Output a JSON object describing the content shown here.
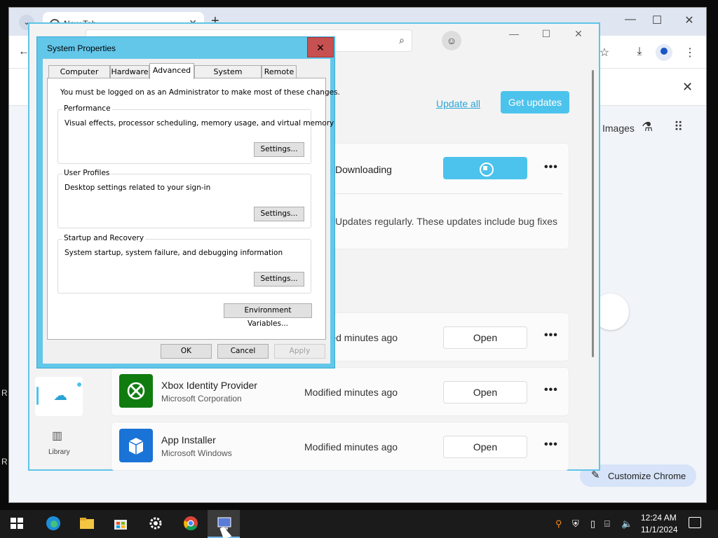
{
  "chrome": {
    "tab_title": "New Tab",
    "infobar_close": "✕",
    "images_link": "Images",
    "customize_label": "Customize Chrome"
  },
  "store": {
    "update_all": "Update all",
    "get_updates": "Get updates",
    "downloading": "Downloading",
    "description": "Updates regularly. These updates include bug fixes",
    "apps": [
      {
        "name": "",
        "publisher": "",
        "modified": "Modified minutes ago",
        "action": "Open"
      },
      {
        "name": "Xbox Identity Provider",
        "publisher": "Microsoft Corporation",
        "modified": "Modified minutes ago",
        "action": "Open"
      },
      {
        "name": "App Installer",
        "publisher": "Microsoft Windows",
        "modified": "Modified minutes ago",
        "action": "Open"
      }
    ],
    "nav_library": "Library"
  },
  "sysprop": {
    "title": "System Properties",
    "close": "✕",
    "tabs": [
      "Computer Name",
      "Hardware",
      "Advanced",
      "System Protection",
      "Remote"
    ],
    "active_tab": "Advanced",
    "admin_note": "You must be logged on as an Administrator to make most of these changes.",
    "groups": [
      {
        "title": "Performance",
        "desc": "Visual effects, processor scheduling, memory usage, and virtual memory",
        "button": "Settings..."
      },
      {
        "title": "User Profiles",
        "desc": "Desktop settings related to your sign-in",
        "button": "Settings..."
      },
      {
        "title": "Startup and Recovery",
        "desc": "System startup, system failure, and debugging information",
        "button": "Settings..."
      }
    ],
    "env_button": "Environment Variables...",
    "ok": "OK",
    "cancel": "Cancel",
    "apply": "Apply"
  },
  "taskbar": {
    "time": "12:24 AM",
    "date": "11/1/2024"
  },
  "desktop": {
    "letter_top": "R",
    "letter_bottom": "R"
  },
  "colors": {
    "store_accent": "#4cc3ec",
    "dialog_frame": "#63c7ea",
    "close_red": "#c75050"
  }
}
